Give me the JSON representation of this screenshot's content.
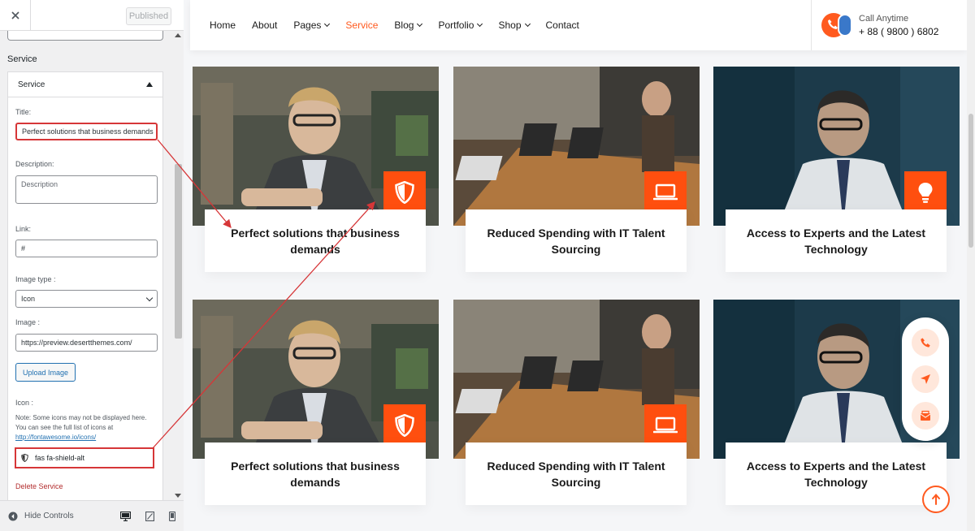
{
  "customizer": {
    "published_label": "Published",
    "section_title": "Service",
    "panel_title": "Service",
    "fields": {
      "title_label": "Title:",
      "title_value": "Perfect solutions that business demands",
      "description_label": "Description:",
      "description_placeholder": "Description",
      "link_label": "Link:",
      "link_value": "#",
      "image_type_label": "Image type :",
      "image_type_value": "Icon",
      "image_label": "Image :",
      "image_value": "https://preview.desertthemes.com/",
      "upload_label": "Upload Image",
      "icon_label": "Icon :",
      "icon_note": "Note: Some icons may not be displayed here. You can see the full list of icons at",
      "icon_note_link": "http://fontawesome.io/icons/",
      "icon_value": "fas fa-shield-alt"
    },
    "delete_label": "Delete Service",
    "hide_controls_label": "Hide Controls"
  },
  "site": {
    "nav": [
      {
        "label": "Home",
        "dropdown": false,
        "active": false
      },
      {
        "label": "About",
        "dropdown": false,
        "active": false
      },
      {
        "label": "Pages",
        "dropdown": true,
        "active": false
      },
      {
        "label": "Service",
        "dropdown": false,
        "active": true
      },
      {
        "label": "Blog",
        "dropdown": true,
        "active": false
      },
      {
        "label": "Portfolio",
        "dropdown": true,
        "active": false
      },
      {
        "label": "Shop",
        "dropdown": true,
        "active": false
      },
      {
        "label": "Contact",
        "dropdown": false,
        "active": false
      }
    ],
    "call_label": "Call Anytime",
    "call_number": "+ 88 ( 9800 ) 6802",
    "cards": [
      {
        "title": "Perfect solutions that business demands",
        "icon": "shield-icon"
      },
      {
        "title": "Reduced Spending with IT Talent Sourcing",
        "icon": "laptop-icon"
      },
      {
        "title": "Access to Experts and the Latest Technology",
        "icon": "lightbulb-icon"
      },
      {
        "title": "Perfect solutions that business demands",
        "icon": "shield-icon"
      },
      {
        "title": "Reduced Spending with IT Talent Sourcing",
        "icon": "laptop-icon"
      },
      {
        "title": "Access to Experts and the Latest Technology",
        "icon": "lightbulb-icon"
      }
    ]
  },
  "colors": {
    "accent": "#ff4f0f",
    "annotation": "#d63638",
    "wp_blue": "#2271b1"
  }
}
